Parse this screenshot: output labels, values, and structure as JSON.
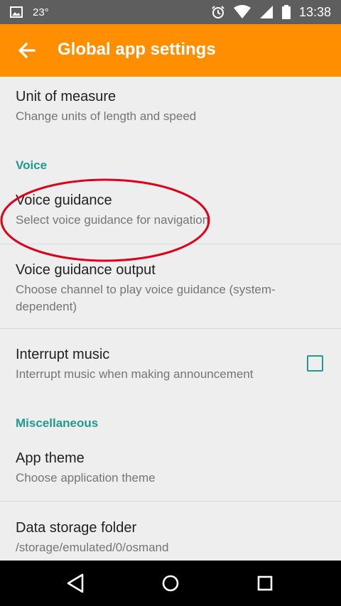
{
  "status_bar": {
    "temperature": "23°",
    "time": "13:38",
    "icons": [
      "image-icon",
      "alarm-icon",
      "wifi-icon",
      "signal-icon",
      "battery-icon"
    ]
  },
  "toolbar": {
    "title": "Global app settings",
    "back_icon": "arrow-left-icon",
    "background": "#ff8f00"
  },
  "settings": {
    "unit_of_measure": {
      "title": "Unit of measure",
      "summary": "Change units of length and speed"
    },
    "voice_category": "Voice",
    "voice_guidance": {
      "title": "Voice guidance",
      "summary": "Select voice guidance for navigation"
    },
    "voice_guidance_output": {
      "title": "Voice guidance output",
      "summary": "Choose channel to play voice guidance (system-dependent)"
    },
    "interrupt_music": {
      "title": "Interrupt music",
      "summary": "Interrupt music when making announcement",
      "checked": false
    },
    "misc_category": "Miscellaneous",
    "app_theme": {
      "title": "App theme",
      "summary": "Choose application theme"
    },
    "data_storage_folder": {
      "title": "Data storage folder",
      "summary": "/storage/emulated/0/osmand"
    }
  },
  "accent_color": "#1e9b8e",
  "annotation_color": "#e0001a",
  "nav_bar": {
    "icons": [
      "back-triangle-icon",
      "home-circle-icon",
      "recents-square-icon"
    ]
  }
}
